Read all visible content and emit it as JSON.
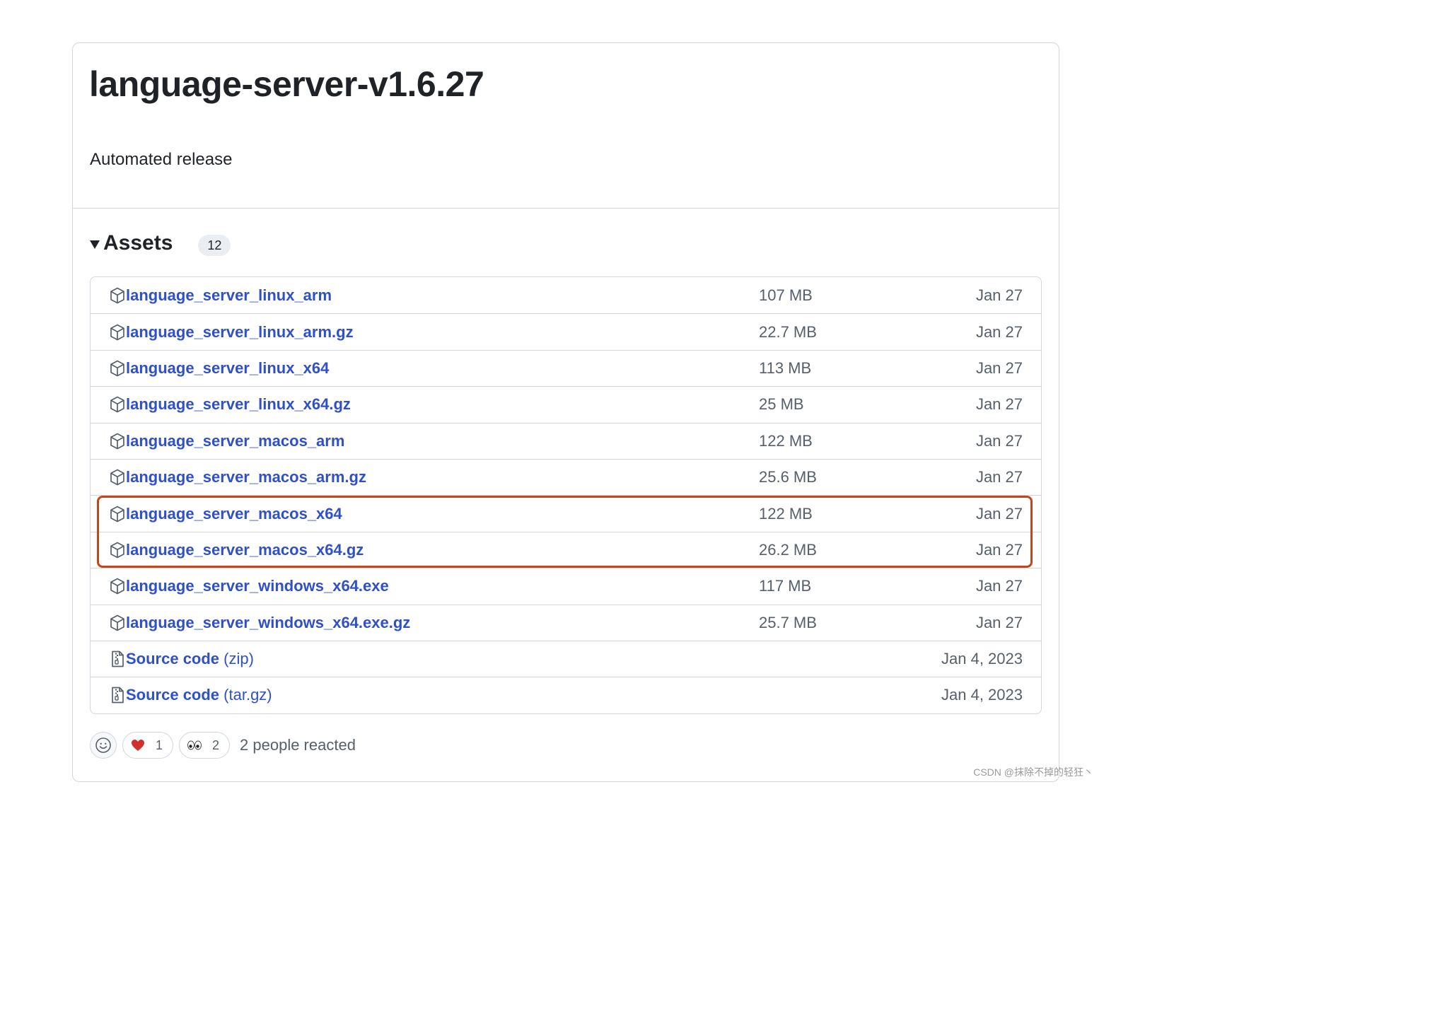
{
  "release": {
    "title": "language-server-v1.6.27",
    "body": "Automated release"
  },
  "assets": {
    "title": "Assets",
    "count": "12",
    "items": [
      {
        "name": "language_server_linux_arm",
        "suffix": "",
        "size": "107 MB",
        "date": "Jan 27",
        "icon": "package-icon"
      },
      {
        "name": "language_server_linux_arm.gz",
        "suffix": "",
        "size": "22.7 MB",
        "date": "Jan 27",
        "icon": "package-icon"
      },
      {
        "name": "language_server_linux_x64",
        "suffix": "",
        "size": "113 MB",
        "date": "Jan 27",
        "icon": "package-icon"
      },
      {
        "name": "language_server_linux_x64.gz",
        "suffix": "",
        "size": "25 MB",
        "date": "Jan 27",
        "icon": "package-icon"
      },
      {
        "name": "language_server_macos_arm",
        "suffix": "",
        "size": "122 MB",
        "date": "Jan 27",
        "icon": "package-icon"
      },
      {
        "name": "language_server_macos_arm.gz",
        "suffix": "",
        "size": "25.6 MB",
        "date": "Jan 27",
        "icon": "package-icon"
      },
      {
        "name": "language_server_macos_x64",
        "suffix": "",
        "size": "122 MB",
        "date": "Jan 27",
        "icon": "package-icon"
      },
      {
        "name": "language_server_macos_x64.gz",
        "suffix": "",
        "size": "26.2 MB",
        "date": "Jan 27",
        "icon": "package-icon"
      },
      {
        "name": "language_server_windows_x64.exe",
        "suffix": "",
        "size": "117 MB",
        "date": "Jan 27",
        "icon": "package-icon"
      },
      {
        "name": "language_server_windows_x64.exe.gz",
        "suffix": "",
        "size": "25.7 MB",
        "date": "Jan 27",
        "icon": "package-icon"
      },
      {
        "name": "Source code",
        "suffix": "(zip)",
        "size": "",
        "date": "Jan 4, 2023",
        "icon": "file-zip-icon"
      },
      {
        "name": "Source code",
        "suffix": "(tar.gz)",
        "size": "",
        "date": "Jan 4, 2023",
        "icon": "file-zip-icon"
      }
    ]
  },
  "reactions": {
    "heart_count": "1",
    "eyes_count": "2",
    "summary": "2 people reacted"
  },
  "watermark": "CSDN @抹除不掉的轻狂丶",
  "colors": {
    "link": "#3050c8",
    "highlight": "#c84317",
    "border": "#d0d7de"
  }
}
